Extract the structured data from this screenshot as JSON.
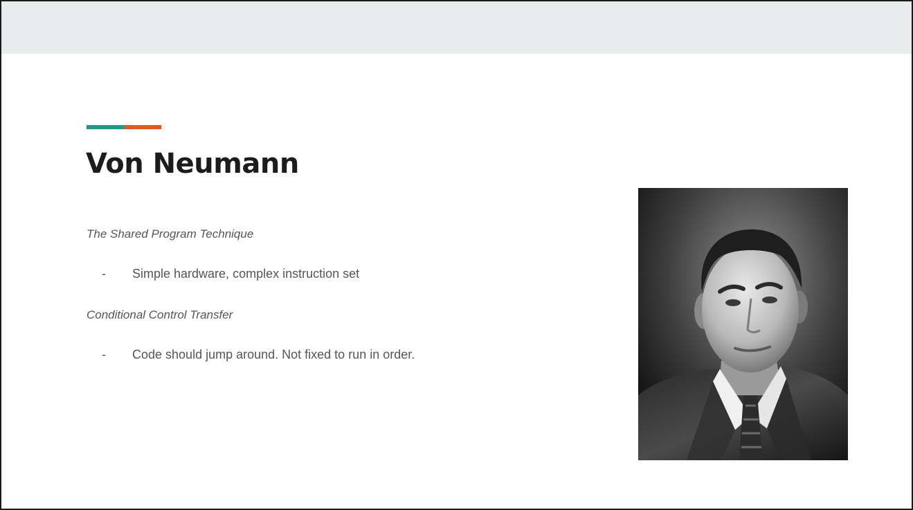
{
  "slide": {
    "title": "Von Neumann",
    "accent_colors": [
      "#26968a",
      "#e4571e"
    ],
    "sections": [
      {
        "heading": "The Shared Program Technique",
        "bullet_marker": "-",
        "bullet": "Simple hardware, complex instruction set"
      },
      {
        "heading": "Conditional Control Transfer",
        "bullet_marker": "-",
        "bullet": "Code should jump around. Not fixed to run in order."
      }
    ]
  },
  "colors": {
    "header_band": "#e8ecec",
    "title_text": "#1c1c1c",
    "body_text": "#555555"
  }
}
